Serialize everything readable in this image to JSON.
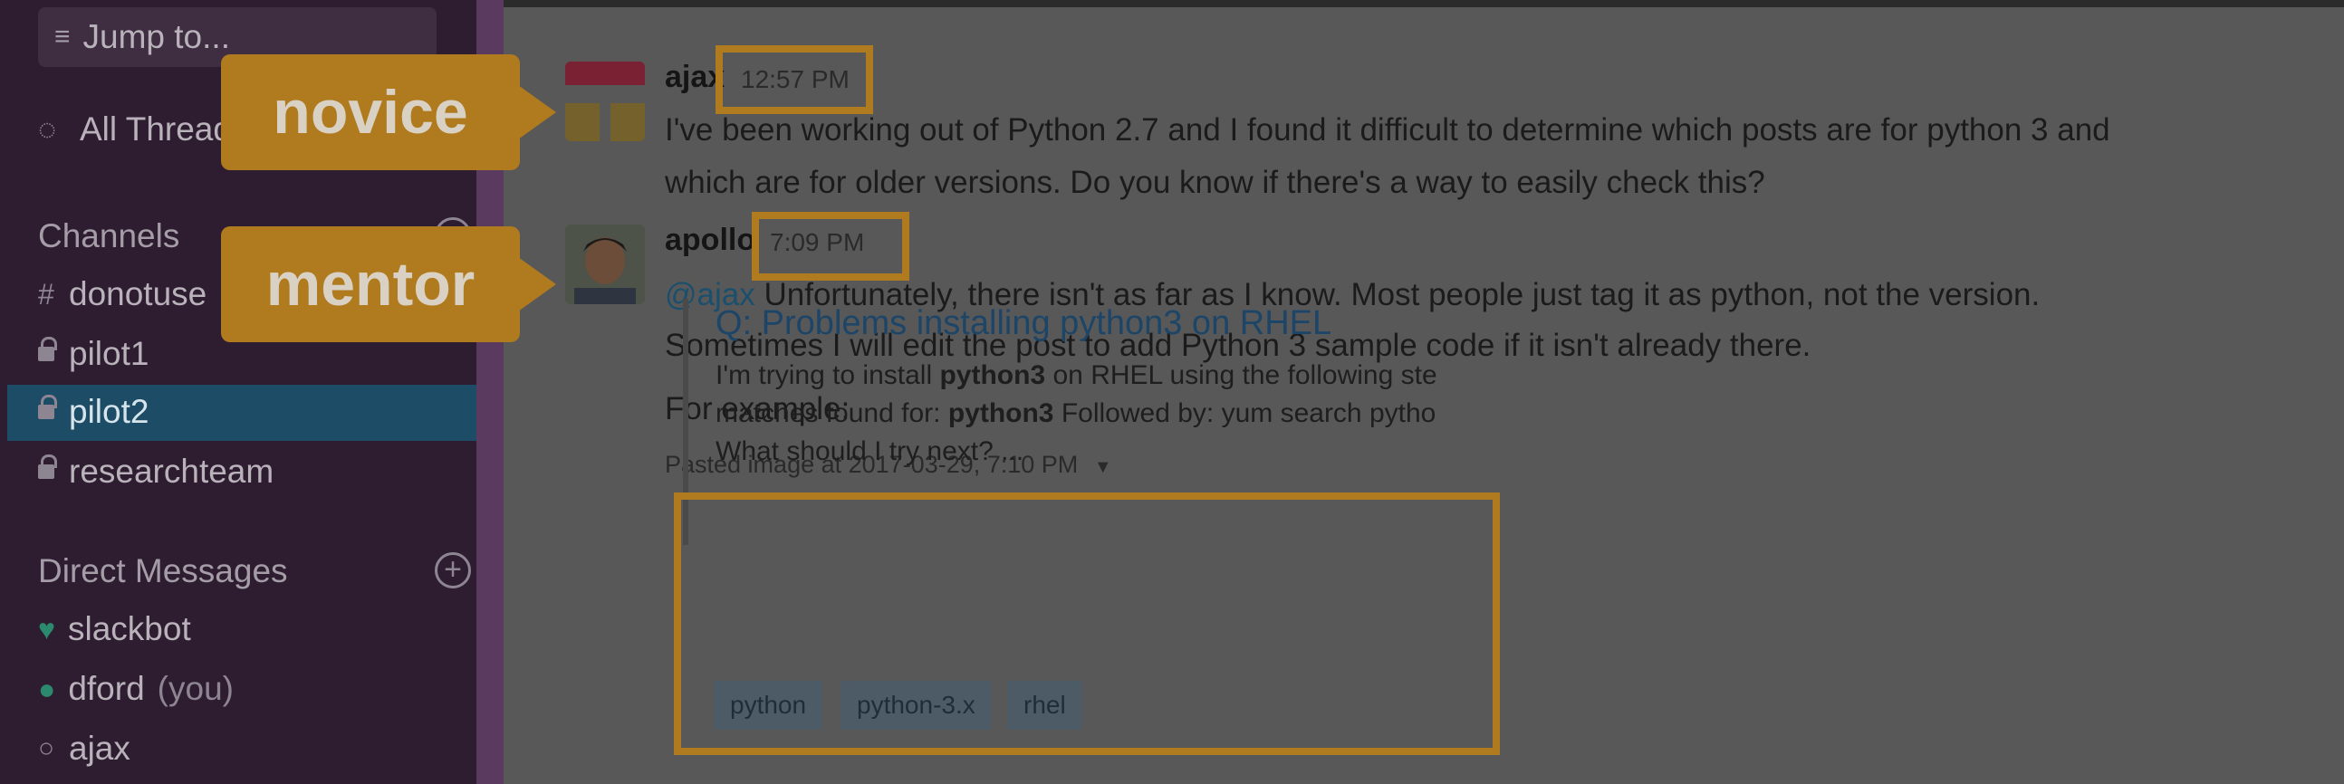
{
  "sidebar": {
    "jump_to": "Jump to...",
    "all_threads": "All Threads",
    "channels_header": "Channels",
    "channels": [
      {
        "label": "donotuse",
        "kind": "public"
      },
      {
        "label": "pilot1",
        "kind": "private"
      },
      {
        "label": "pilot2",
        "kind": "private",
        "active": true
      },
      {
        "label": "researchteam",
        "kind": "private"
      }
    ],
    "dm_header": "Direct Messages",
    "dms": [
      {
        "label": "slackbot"
      },
      {
        "label": "dford",
        "suffix": "(you)"
      },
      {
        "label": "ajax"
      }
    ]
  },
  "messages": [
    {
      "author": "ajax",
      "time": "12:57 PM",
      "lines": [
        "I've been working out of Python 2.7 and I found it difficult to determine which posts are for python 3 and",
        "which are for older versions. Do you know if there's a way to easily check this?"
      ]
    },
    {
      "author": "apollo",
      "time": "7:09 PM",
      "mention": "@ajax",
      "lines": [
        "Unfortunately, there isn't as far as I know. Most people just tag it as python, not the version.",
        "Sometimes I will edit the post to add Python 3 sample code if it isn't already there."
      ],
      "followup": "For example:",
      "attachment": {
        "meta": "Pasted image at 2017-03-29, 7:10 PM",
        "title": "Q: Problems installing python3 on RHEL",
        "text_lines": [
          {
            "pre": "I'm trying to install ",
            "bold": "python3",
            "post": " on RHEL using the following ste"
          },
          {
            "pre": "matches found for: ",
            "bold": "python3",
            "post": " Followed by: yum search pytho"
          },
          {
            "pre": "What should I try next? ...",
            "bold": "",
            "post": ""
          }
        ],
        "tags": [
          "python",
          "python-3.x",
          "rhel"
        ]
      }
    }
  ],
  "annotations": {
    "novice_label": "novice",
    "mentor_label": "mentor",
    "accent_color": "#b07a1e"
  },
  "colors": {
    "sidebar_bg": "#2e1d30",
    "active_channel": "#1d4c66",
    "main_bg": "#585858"
  }
}
